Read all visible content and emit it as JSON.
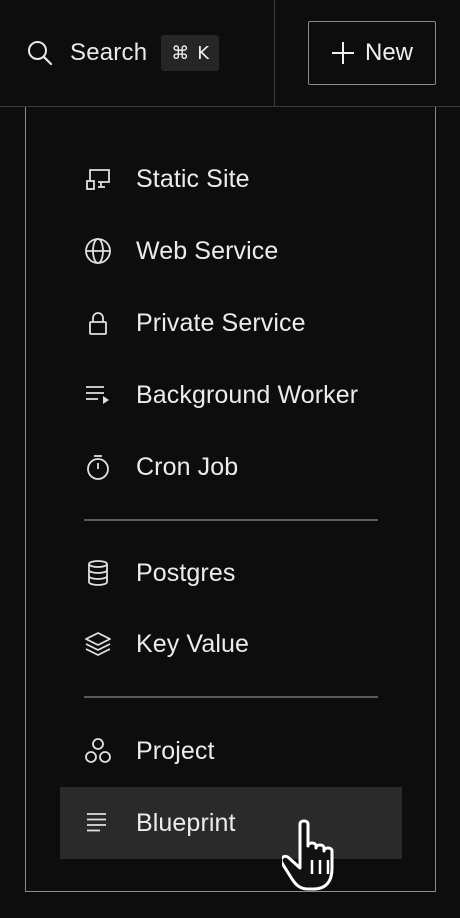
{
  "search": {
    "label": "Search",
    "shortcut_mod": "⌘",
    "shortcut_key": "K",
    "icon": "search-icon"
  },
  "new_button": {
    "label": "New",
    "icon": "plus-icon"
  },
  "menu": {
    "groups": [
      {
        "items": [
          {
            "label": "Static Site",
            "icon": "static-site-icon"
          },
          {
            "label": "Web Service",
            "icon": "globe-icon"
          },
          {
            "label": "Private Service",
            "icon": "lock-icon"
          },
          {
            "label": "Background Worker",
            "icon": "worker-list-icon"
          },
          {
            "label": "Cron Job",
            "icon": "stopwatch-icon"
          }
        ]
      },
      {
        "items": [
          {
            "label": "Postgres",
            "icon": "database-icon"
          },
          {
            "label": "Key Value",
            "icon": "layers-icon"
          }
        ]
      },
      {
        "items": [
          {
            "label": "Project",
            "icon": "project-hexagons-icon"
          },
          {
            "label": "Blueprint",
            "icon": "blueprint-lines-icon",
            "hovered": true
          }
        ]
      }
    ]
  },
  "colors": {
    "background": "#0d0d0d",
    "border": "#8a8a8a",
    "hover": "#2a2a2a",
    "text": "#ececec"
  }
}
